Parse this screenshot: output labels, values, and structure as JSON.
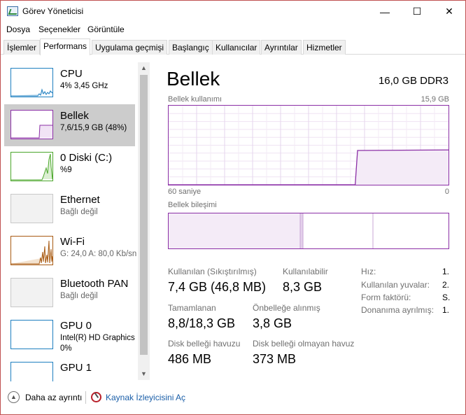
{
  "window": {
    "title": "Görev Yöneticisi",
    "controls": {
      "minimize": "—",
      "maximize": "☐",
      "close": "✕"
    }
  },
  "menu": [
    "Dosya",
    "Seçenekler",
    "Görüntüle"
  ],
  "tabs": [
    "İşlemler",
    "Performans",
    "Uygulama geçmişi",
    "Başlangıç",
    "Kullanıcılar",
    "Ayrıntılar",
    "Hizmetler"
  ],
  "active_tab": "Performans",
  "sidebar": {
    "items": [
      {
        "name": "CPU",
        "detail": "4%  3,45 GHz",
        "color": "#1e7fc0",
        "selected": false
      },
      {
        "name": "Bellek",
        "detail": "7,6/15,9 GB (48%)",
        "color": "#8b2fa6",
        "selected": true
      },
      {
        "name": "0 Diski (C:)",
        "detail": "%9",
        "color": "#4aa62a",
        "selected": false
      },
      {
        "name": "Ethernet",
        "detail": "Bağlı değil",
        "color": "#b0b0b0",
        "selected": false
      },
      {
        "name": "Wi-Fi",
        "detail": "G: 24,0  A: 80,0 Kb/sn",
        "color": "#a85a12",
        "selected": false
      },
      {
        "name": "Bluetooth PAN",
        "detail": "Bağlı değil",
        "color": "#b0b0b0",
        "selected": false
      },
      {
        "name": "GPU 0",
        "detail": "Intel(R) HD Graphics",
        "detail2": "0%",
        "color": "#1e7fc0",
        "selected": false
      },
      {
        "name": "GPU 1",
        "detail": "",
        "color": "#1e7fc0",
        "selected": false
      }
    ]
  },
  "main": {
    "title": "Bellek",
    "capacity": "16,0 GB DDR3",
    "usage_label": "Bellek kullanımı",
    "usage_max": "15,9 GB",
    "time_span_label": "60 saniye",
    "time_end_label": "0",
    "composition_label": "Bellek bileşimi",
    "usage_graph": {
      "max_gb": 15.9,
      "points_seconds_ago": [
        60,
        20,
        19.5,
        0
      ],
      "points_gb": [
        0,
        0,
        6.9,
        7.0
      ]
    },
    "composition": {
      "in_use_fraction": 0.47,
      "modified_fraction": 0.01,
      "standby_fraction": 0.25
    },
    "stats": [
      {
        "label": "Kullanılan (Sıkıştırılmış)",
        "value": "7,4 GB (46,8 MB)"
      },
      {
        "label": "Kullanılabilir",
        "value": "8,3 GB"
      },
      {
        "label": "Tamamlanan",
        "value": "8,8/18,3 GB"
      },
      {
        "label": "Önbelleğe alınmış",
        "value": "3,8 GB"
      },
      {
        "label": "Disk belleği havuzu",
        "value": "486 MB"
      },
      {
        "label": "Disk belleği olmayan havuz",
        "value": "373 MB"
      }
    ],
    "properties": [
      {
        "label": "Hız:",
        "value": "1."
      },
      {
        "label": "Kullanılan yuvalar:",
        "value": "2."
      },
      {
        "label": "Form faktörü:",
        "value": "S."
      },
      {
        "label": "Donanıma ayrılmış:",
        "value": "1."
      }
    ]
  },
  "footer": {
    "fewer_details": "Daha az ayrıntı",
    "resource_monitor": "Kaynak İzleyicisini Aç"
  }
}
